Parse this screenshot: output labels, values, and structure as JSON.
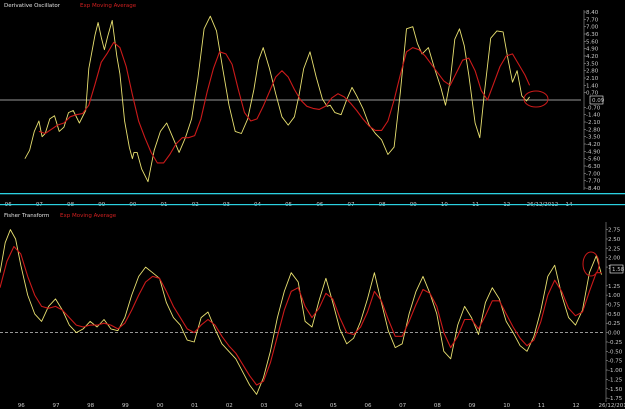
{
  "colors": {
    "background": "#000000",
    "oscillator_line": "#e8e070",
    "moving_average_line": "#cc1a1a",
    "divider": "#2bd0e0",
    "zero_line_top": "#c8c8c8",
    "zero_line_bottom": "#c8c8c8",
    "label_box": "#ffffff"
  },
  "chart_data": [
    {
      "type": "line",
      "title": "Derivative Oscillator",
      "series": [
        {
          "name": "Derivative Oscillator",
          "x": [
            1996.55,
            1996.7,
            1996.85,
            1997.0,
            1997.1,
            1997.2,
            1997.35,
            1997.5,
            1997.65,
            1997.8,
            1997.95,
            1998.1,
            1998.3,
            1998.5,
            1998.6,
            1998.8,
            1998.9,
            1999.0,
            1999.1,
            1999.2,
            1999.35,
            1999.5,
            1999.6,
            1999.75,
            1999.9,
            2000.0,
            2000.05,
            2000.15,
            2000.3,
            2000.5,
            2000.7,
            2000.9,
            2001.1,
            2001.3,
            2001.5,
            2001.7,
            2001.9,
            2002.1,
            2002.3,
            2002.5,
            2002.7,
            2002.9,
            2003.1,
            2003.3,
            2003.5,
            2003.7,
            2003.9,
            2004.05,
            2004.2,
            2004.4,
            2004.6,
            2004.8,
            2005.0,
            2005.2,
            2005.35,
            2005.5,
            2005.7,
            2005.9,
            2006.1,
            2006.25,
            2006.35,
            2006.5,
            2006.7,
            2006.9,
            2007.05,
            2007.2,
            2007.4,
            2007.6,
            2007.8,
            2008.0,
            2008.2,
            2008.4,
            2008.6,
            2008.8,
            2009.0,
            2009.15,
            2009.3,
            2009.5,
            2009.7,
            2009.9,
            2010.05,
            2010.2,
            2010.35,
            2010.5,
            2010.65,
            2010.8,
            2011.0,
            2011.15,
            2011.3,
            2011.5,
            2011.7,
            2011.9,
            2012.05,
            2012.2,
            2012.35,
            2012.5,
            2012.65,
            2012.75
          ],
          "values": [
            -5.6,
            -4.8,
            -3.0,
            -2.0,
            -3.5,
            -3.2,
            -1.8,
            -1.5,
            -3.0,
            -2.6,
            -1.2,
            -1.0,
            -2.2,
            -1.0,
            3.0,
            6.2,
            7.4,
            6.0,
            4.8,
            6.0,
            7.6,
            4.2,
            2.5,
            -2.0,
            -4.5,
            -5.6,
            -5.0,
            -5.0,
            -6.6,
            -7.8,
            -4.8,
            -3.0,
            -2.2,
            -3.6,
            -5.0,
            -3.6,
            -1.8,
            2.0,
            6.8,
            8.0,
            6.6,
            3.0,
            -0.5,
            -3.0,
            -3.2,
            -1.8,
            1.0,
            3.8,
            5.0,
            3.0,
            0.6,
            -1.6,
            -2.4,
            -1.6,
            0.5,
            3.0,
            4.6,
            2.2,
            0.1,
            -0.6,
            -0.5,
            -1.2,
            -1.4,
            0.2,
            1.2,
            0.4,
            -0.8,
            -2.4,
            -3.2,
            -3.8,
            -5.2,
            -4.5,
            0.7,
            6.8,
            7.0,
            5.4,
            4.4,
            5.0,
            3.0,
            1.2,
            -0.5,
            1.8,
            5.8,
            6.8,
            5.2,
            2.4,
            -2.2,
            -3.6,
            0.7,
            5.9,
            6.6,
            6.5,
            4.0,
            1.7,
            2.8,
            0.4,
            -0.1,
            0.3
          ]
        },
        {
          "name": "Exp Moving Average",
          "x": [
            1997.0,
            1997.2,
            1997.4,
            1997.6,
            1997.8,
            1998.0,
            1998.2,
            1998.4,
            1998.6,
            1998.8,
            1999.0,
            1999.2,
            1999.4,
            1999.6,
            1999.8,
            2000.0,
            2000.2,
            2000.4,
            2000.6,
            2000.8,
            2001.0,
            2001.2,
            2001.4,
            2001.6,
            2001.8,
            2002.0,
            2002.2,
            2002.4,
            2002.6,
            2002.8,
            2003.0,
            2003.2,
            2003.4,
            2003.6,
            2003.8,
            2004.0,
            2004.2,
            2004.4,
            2004.6,
            2004.8,
            2005.0,
            2005.2,
            2005.4,
            2005.6,
            2005.8,
            2006.0,
            2006.2,
            2006.4,
            2006.6,
            2006.8,
            2007.0,
            2007.2,
            2007.4,
            2007.6,
            2007.8,
            2008.0,
            2008.2,
            2008.4,
            2008.6,
            2008.8,
            2009.0,
            2009.2,
            2009.4,
            2009.6,
            2009.8,
            2010.0,
            2010.2,
            2010.4,
            2010.6,
            2010.8,
            2011.0,
            2011.2,
            2011.4,
            2011.6,
            2011.8,
            2012.0,
            2012.2,
            2012.4,
            2012.6,
            2012.75
          ],
          "values": [
            -3.0,
            -3.2,
            -2.8,
            -2.4,
            -2.2,
            -1.6,
            -1.4,
            -1.3,
            -0.5,
            1.5,
            3.6,
            4.5,
            5.5,
            5.0,
            3.2,
            0.5,
            -2.0,
            -3.6,
            -5.0,
            -6.0,
            -6.0,
            -5.2,
            -4.2,
            -3.6,
            -3.6,
            -3.4,
            -1.8,
            0.8,
            3.0,
            4.6,
            4.4,
            3.4,
            1.0,
            -1.2,
            -2.0,
            -1.8,
            -0.6,
            0.8,
            2.2,
            2.8,
            2.2,
            1.0,
            0.0,
            -0.6,
            -0.8,
            -0.9,
            -0.6,
            0.2,
            0.6,
            0.3,
            -0.3,
            -1.0,
            -1.8,
            -2.5,
            -2.9,
            -2.9,
            -2.0,
            0.0,
            2.4,
            4.6,
            5.0,
            4.8,
            4.2,
            3.4,
            2.6,
            1.8,
            1.4,
            2.6,
            3.8,
            4.0,
            2.8,
            0.9,
            0.0,
            1.6,
            3.2,
            4.2,
            4.4,
            3.4,
            2.4,
            1.4
          ]
        }
      ],
      "legend": [
        "Derivative Oscillator",
        "Exp Moving Average"
      ],
      "ylim": [
        -8.4,
        8.4
      ],
      "y_ticks": [
        "8.40",
        "7.70",
        "7.00",
        "6.30",
        "5.60",
        "4.90",
        "4.20",
        "3.50",
        "2.80",
        "2.10",
        "1.40",
        "0.70",
        "-0.70",
        "-1.40",
        "-2.10",
        "-2.80",
        "-3.50",
        "-4.20",
        "-4.90",
        "-5.60",
        "-6.30",
        "-7.00",
        "-7.70",
        "-8.40"
      ],
      "current_value_label": "0.09",
      "x_tick_labels": [
        "96",
        "97",
        "98",
        "99",
        "00",
        "01",
        "02",
        "03",
        "04",
        "05",
        "06",
        "07",
        "08",
        "09",
        "10",
        "11",
        "12",
        "26/12/2012",
        "14"
      ],
      "grid": false
    },
    {
      "type": "line",
      "title": "Fisher Transform",
      "series": [
        {
          "name": "Fisher Transform",
          "x": [
            1995.4,
            1995.55,
            1995.7,
            1995.85,
            1996.0,
            1996.2,
            1996.4,
            1996.6,
            1996.8,
            1997.0,
            1997.2,
            1997.4,
            1997.6,
            1997.8,
            1998.0,
            1998.2,
            1998.4,
            1998.6,
            1998.8,
            1999.0,
            1999.2,
            1999.4,
            1999.6,
            1999.8,
            2000.0,
            2000.2,
            2000.4,
            2000.6,
            2000.8,
            2001.0,
            2001.2,
            2001.4,
            2001.6,
            2001.8,
            2002.0,
            2002.2,
            2002.4,
            2002.6,
            2002.8,
            2003.0,
            2003.2,
            2003.4,
            2003.6,
            2003.8,
            2004.0,
            2004.2,
            2004.4,
            2004.6,
            2004.8,
            2005.0,
            2005.2,
            2005.4,
            2005.6,
            2005.8,
            2006.0,
            2006.2,
            2006.4,
            2006.6,
            2006.8,
            2007.0,
            2007.2,
            2007.4,
            2007.6,
            2007.8,
            2008.0,
            2008.2,
            2008.4,
            2008.6,
            2008.8,
            2009.0,
            2009.2,
            2009.4,
            2009.6,
            2009.8,
            2010.0,
            2010.2,
            2010.4,
            2010.6,
            2010.8,
            2011.0,
            2011.2,
            2011.4,
            2011.6,
            2011.8,
            2012.0,
            2012.2,
            2012.4,
            2012.6,
            2012.75
          ],
          "values": [
            1.6,
            2.4,
            2.75,
            2.5,
            1.8,
            1.0,
            0.5,
            0.3,
            0.7,
            0.9,
            0.6,
            0.2,
            0.0,
            0.1,
            0.3,
            0.15,
            0.35,
            0.1,
            0.05,
            0.4,
            1.0,
            1.5,
            1.75,
            1.6,
            1.45,
            0.8,
            0.4,
            0.2,
            -0.2,
            -0.25,
            0.4,
            0.55,
            0.1,
            -0.3,
            -0.5,
            -0.7,
            -1.05,
            -1.4,
            -1.65,
            -1.2,
            -0.5,
            0.4,
            1.1,
            1.6,
            1.35,
            0.3,
            0.15,
            0.85,
            1.45,
            0.8,
            0.1,
            -0.3,
            -0.15,
            0.3,
            0.9,
            1.6,
            0.8,
            0.05,
            -0.4,
            -0.3,
            0.5,
            1.1,
            1.5,
            1.05,
            0.5,
            -0.5,
            -0.7,
            0.2,
            0.7,
            0.4,
            -0.05,
            0.8,
            1.2,
            0.9,
            0.3,
            0.0,
            -0.35,
            -0.5,
            -0.1,
            0.6,
            1.5,
            1.8,
            1.0,
            0.4,
            0.2,
            0.6,
            1.6,
            2.05,
            1.55
          ]
        },
        {
          "name": "Exp Moving Average",
          "x": [
            1995.4,
            1995.6,
            1995.8,
            1996.0,
            1996.2,
            1996.4,
            1996.6,
            1996.8,
            1997.0,
            1997.2,
            1997.4,
            1997.6,
            1997.8,
            1998.0,
            1998.2,
            1998.4,
            1998.6,
            1998.8,
            1999.0,
            1999.2,
            1999.4,
            1999.6,
            1999.8,
            2000.0,
            2000.2,
            2000.4,
            2000.6,
            2000.8,
            2001.0,
            2001.2,
            2001.4,
            2001.6,
            2001.8,
            2002.0,
            2002.2,
            2002.4,
            2002.6,
            2002.8,
            2003.0,
            2003.2,
            2003.4,
            2003.6,
            2003.8,
            2004.0,
            2004.2,
            2004.4,
            2004.6,
            2004.8,
            2005.0,
            2005.2,
            2005.4,
            2005.6,
            2005.8,
            2006.0,
            2006.2,
            2006.4,
            2006.6,
            2006.8,
            2007.0,
            2007.2,
            2007.4,
            2007.6,
            2007.8,
            2008.0,
            2008.2,
            2008.4,
            2008.6,
            2008.8,
            2009.0,
            2009.2,
            2009.4,
            2009.6,
            2009.8,
            2010.0,
            2010.2,
            2010.4,
            2010.6,
            2010.8,
            2011.0,
            2011.2,
            2011.4,
            2011.6,
            2011.8,
            2012.0,
            2012.2,
            2012.4,
            2012.6,
            2012.75
          ],
          "values": [
            1.2,
            1.9,
            2.3,
            2.1,
            1.5,
            1.0,
            0.7,
            0.65,
            0.7,
            0.6,
            0.4,
            0.2,
            0.15,
            0.2,
            0.2,
            0.25,
            0.2,
            0.1,
            0.25,
            0.6,
            1.0,
            1.35,
            1.5,
            1.45,
            1.1,
            0.7,
            0.4,
            0.1,
            0.0,
            0.2,
            0.35,
            0.2,
            -0.1,
            -0.35,
            -0.55,
            -0.85,
            -1.15,
            -1.4,
            -1.3,
            -0.8,
            -0.1,
            0.6,
            1.1,
            1.2,
            0.7,
            0.4,
            0.65,
            1.05,
            0.9,
            0.4,
            0.0,
            -0.05,
            0.15,
            0.55,
            1.1,
            0.85,
            0.35,
            -0.1,
            -0.1,
            0.3,
            0.75,
            1.15,
            1.05,
            0.7,
            0.0,
            -0.4,
            -0.1,
            0.35,
            0.35,
            0.1,
            0.45,
            0.85,
            0.85,
            0.5,
            0.15,
            -0.15,
            -0.35,
            -0.2,
            0.3,
            1.0,
            1.4,
            1.1,
            0.65,
            0.45,
            0.55,
            1.1,
            1.6,
            1.6
          ]
        }
      ],
      "legend": [
        "Fisher Transform",
        "Exp Moving Average"
      ],
      "ylim": [
        -1.8,
        2.9
      ],
      "y_ticks": [
        "2.75",
        "2.50",
        "2.25",
        "2.00",
        "1.75",
        "1.25",
        "1.00",
        "0.75",
        "0.50",
        "0.25",
        "0.00",
        "-0.25",
        "-0.50",
        "-0.75",
        "-1.00",
        "-1.25",
        "-1.50",
        "-1.75"
      ],
      "current_value_label": "1.58",
      "x_tick_labels": [
        "96",
        "97",
        "98",
        "99",
        "00",
        "01",
        "02",
        "03",
        "04",
        "05",
        "06",
        "07",
        "08",
        "09",
        "10",
        "11",
        "12",
        "26/12/2012"
      ],
      "grid": false
    }
  ]
}
